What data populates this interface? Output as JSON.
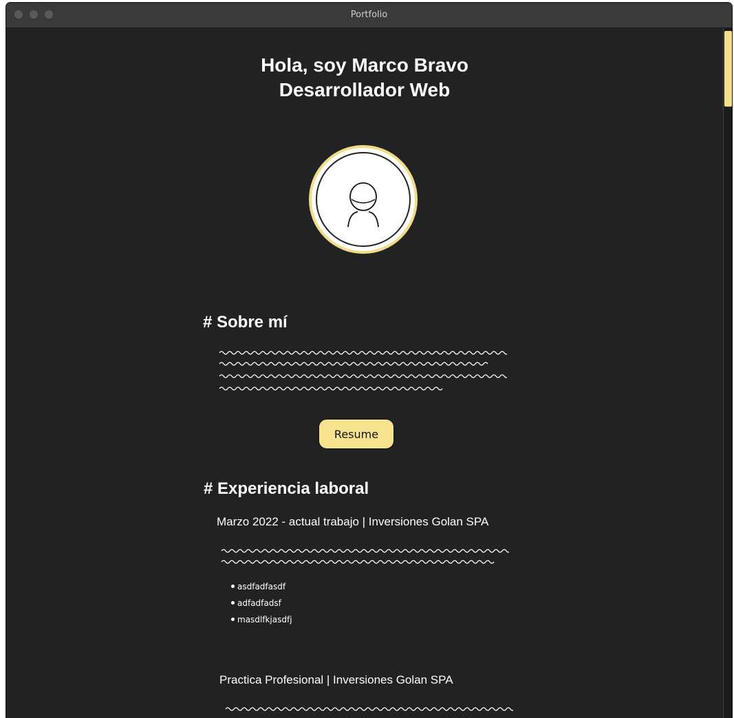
{
  "window": {
    "title": "Portfolio"
  },
  "hero": {
    "line1": "Hola, soy Marco Bravo",
    "line2": "Desarrollador Web"
  },
  "avatar": {
    "icon": "user-silhouette-icon",
    "ring_color": "#f2dc86"
  },
  "about": {
    "heading": "# Sobre mí",
    "resume_label": "Resume"
  },
  "experience": {
    "heading": "# Experiencia laboral",
    "jobs": [
      {
        "title": "Marzo 2022 - actual trabajo | Inversiones Golan SPA",
        "bullets": [
          "asdfadfasdf",
          "adfadfadsf",
          "masdlfkjasdfj"
        ]
      },
      {
        "title": "Practica Profesional | Inversiones Golan SPA"
      }
    ]
  },
  "colors": {
    "background": "#222222",
    "accent": "#f7e38f",
    "text": "#ffffff"
  }
}
